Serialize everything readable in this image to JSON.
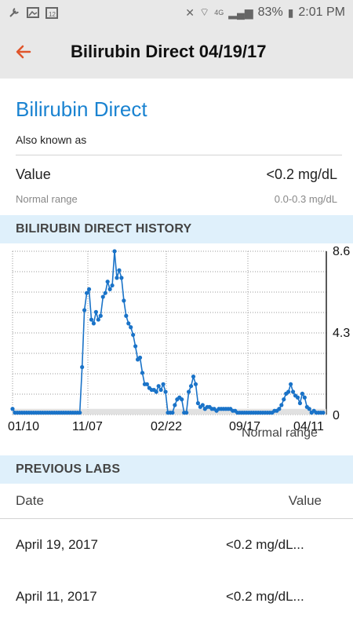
{
  "status_bar": {
    "battery": "83%",
    "time": "2:01 PM",
    "network": "4G"
  },
  "toolbar": {
    "title": "Bilirubin Direct 04/19/17",
    "back_icon": "arrow-left-icon",
    "accent": "#e0552b"
  },
  "lab": {
    "name": "Bilirubin Direct",
    "aka_label": "Also known as",
    "value_label": "Value",
    "value": "<0.2 mg/dL",
    "normal_range_label": "Normal range",
    "normal_range_value": "0.0-0.3 mg/dL"
  },
  "history": {
    "header": "BILIRUBIN DIRECT HISTORY",
    "normal_range_note": "Normal range"
  },
  "chart_data": {
    "type": "line",
    "x_tick_labels": [
      "01/10",
      "11/07",
      "02/22",
      "09/17",
      "04/11"
    ],
    "y_tick_labels": [
      "8.6",
      "4.3",
      "0"
    ],
    "ylim": [
      0,
      8.6
    ],
    "normal_range": [
      0.0,
      0.3
    ],
    "grid": true,
    "series": [
      {
        "color": "#1a73c8",
        "values": [
          0.3,
          0.1,
          0.1,
          0.1,
          0.1,
          0.1,
          0.1,
          0.1,
          0.1,
          0.1,
          0.1,
          0.1,
          0.1,
          0.1,
          0.1,
          0.1,
          0.1,
          0.1,
          0.1,
          0.1,
          0.1,
          0.1,
          0.1,
          0.1,
          0.1,
          0.1,
          0.1,
          0.1,
          0.1,
          0.1,
          2.5,
          5.5,
          6.4,
          6.6,
          5.0,
          4.8,
          5.4,
          5.0,
          5.2,
          6.2,
          6.4,
          7.0,
          6.6,
          6.8,
          8.6,
          7.2,
          7.6,
          7.2,
          6.0,
          5.2,
          4.8,
          4.6,
          4.2,
          3.6,
          2.9,
          3.0,
          2.2,
          1.6,
          1.6,
          1.4,
          1.3,
          1.3,
          1.2,
          1.5,
          1.3,
          1.6,
          1.2,
          0.1,
          0.1,
          0.1,
          0.5,
          0.8,
          0.9,
          0.8,
          0.1,
          0.1,
          1.2,
          1.5,
          2.0,
          1.6,
          0.6,
          0.4,
          0.5,
          0.3,
          0.4,
          0.4,
          0.3,
          0.3,
          0.2,
          0.3,
          0.3,
          0.3,
          0.3,
          0.3,
          0.3,
          0.2,
          0.2,
          0.1,
          0.1,
          0.1,
          0.1,
          0.1,
          0.1,
          0.1,
          0.1,
          0.1,
          0.1,
          0.1,
          0.1,
          0.1,
          0.1,
          0.1,
          0.1,
          0.2,
          0.2,
          0.3,
          0.5,
          0.8,
          1.1,
          1.2,
          1.6,
          1.2,
          1.0,
          0.9,
          0.6,
          1.1,
          0.9,
          0.4,
          0.3,
          0.1,
          0.2,
          0.1,
          0.1,
          0.1,
          0.1
        ]
      }
    ]
  },
  "previous_labs": {
    "header": "PREVIOUS LABS",
    "date_col": "Date",
    "value_col": "Value",
    "rows": [
      {
        "date": "April 19, 2017",
        "value": "<0.2 mg/dL..."
      },
      {
        "date": "April 11, 2017",
        "value": "<0.2 mg/dL..."
      }
    ]
  }
}
